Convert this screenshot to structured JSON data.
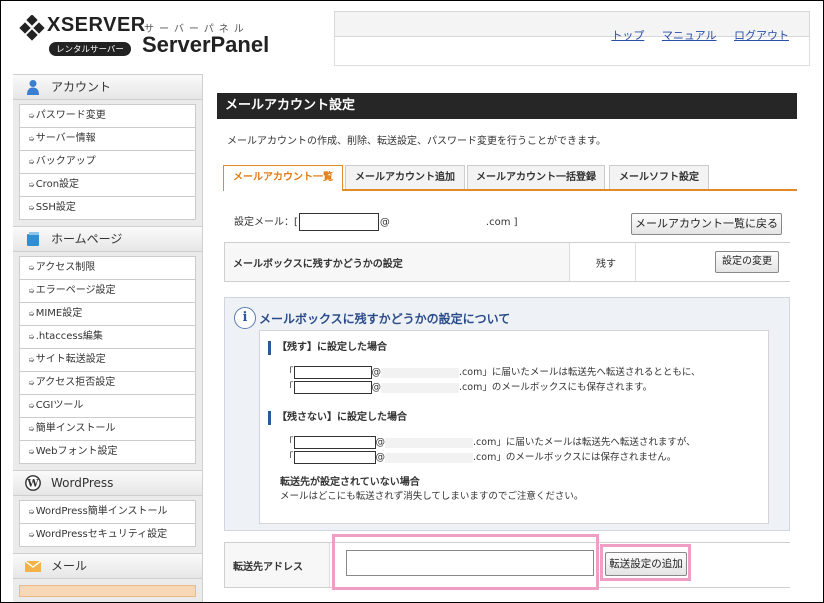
{
  "header": {
    "brand": "XSERVER",
    "badge": "レンタルサーバー",
    "kana": "サーバーパネル",
    "title": "ServerPanel",
    "links": [
      "トップ",
      "マニュアル",
      "ログアウト"
    ]
  },
  "sidebar": {
    "sections": [
      {
        "title": "アカウント",
        "icon": "user-icon",
        "items": [
          "パスワード変更",
          "サーバー情報",
          "バックアップ",
          "Cron設定",
          "SSH設定"
        ]
      },
      {
        "title": "ホームページ",
        "icon": "book-icon",
        "items": [
          "アクセス制限",
          "エラーページ設定",
          "MIME設定",
          ".htaccess編集",
          "サイト転送設定",
          "アクセス拒否設定",
          "CGIツール",
          "簡単インストール",
          "Webフォント設定"
        ]
      },
      {
        "title": "WordPress",
        "icon": "wordpress-icon",
        "items": [
          "WordPress簡単インストール",
          "WordPressセキュリティ設定"
        ]
      },
      {
        "title": "メール",
        "icon": "mail-icon",
        "items": []
      }
    ]
  },
  "main": {
    "title": "メールアカウント設定",
    "description": "メールアカウントの作成、削除、転送設定、パスワード変更を行うことができます。",
    "tabs": [
      {
        "label": "メールアカウント一覧",
        "active": true
      },
      {
        "label": "メールアカウント追加",
        "active": false
      },
      {
        "label": "メールアカウント一括登録",
        "active": false
      },
      {
        "label": "メールソフト設定",
        "active": false
      }
    ],
    "setting_mail_prefix": "設定メール：[",
    "setting_mail_at": "@",
    "setting_mail_suffix": ".com ]",
    "back_button": "メールアカウント一覧に戻る",
    "mailbox_keep": {
      "label": "メールボックスに残すかどうかの設定",
      "value": "残す",
      "change_button": "設定の変更"
    },
    "info": {
      "title": "メールボックスに残すかどうかの設定について",
      "keep_heading": "【残す】に設定した場合",
      "keep_line1": ".com」に届いたメールは転送先へ転送されるとともに、",
      "keep_line2": ".com」のメールボックスにも保存されます。",
      "nokeep_heading": "【残さない】に設定した場合",
      "nokeep_line1": ".com」に届いたメールは転送先へ転送されますが、",
      "nokeep_line2": ".com」のメールボックスには保存されません。",
      "none_heading": "転送先が設定されていない場合",
      "none_line": "メールはどこにも転送されず消失してしまいますのでご注意ください。",
      "bracket_open": "「",
      "at": "@"
    },
    "forward": {
      "label": "転送先アドレス",
      "input_value": "",
      "add_button": "転送設定の追加"
    },
    "accent_color": "#e08a28",
    "highlight_color": "#ef9fc3"
  }
}
